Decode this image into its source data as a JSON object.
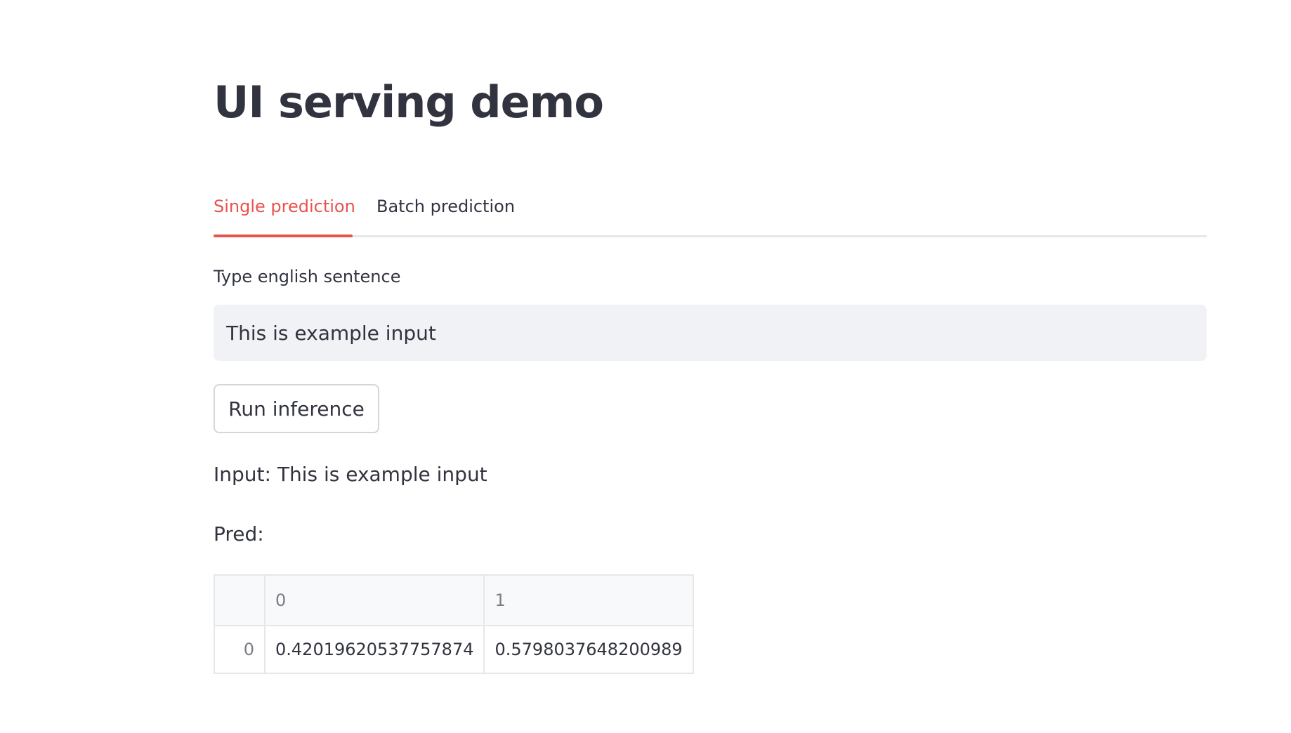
{
  "header": {
    "title": "UI serving demo"
  },
  "tabs": [
    {
      "label": "Single prediction",
      "active": true
    },
    {
      "label": "Batch prediction",
      "active": false
    }
  ],
  "form": {
    "label": "Type english sentence",
    "value": "This is example input",
    "button_label": "Run inference"
  },
  "output": {
    "input_text": "Input: This is example input",
    "pred_label": "Pred:"
  },
  "table": {
    "columns": [
      "0",
      "1"
    ],
    "rows": [
      {
        "index": "0",
        "cells": [
          "0.42019620537757874",
          "0.5798037648200989"
        ]
      }
    ]
  },
  "colors": {
    "accent": "#e8534e",
    "text": "#31333f",
    "input_bg": "#f0f2f6"
  }
}
